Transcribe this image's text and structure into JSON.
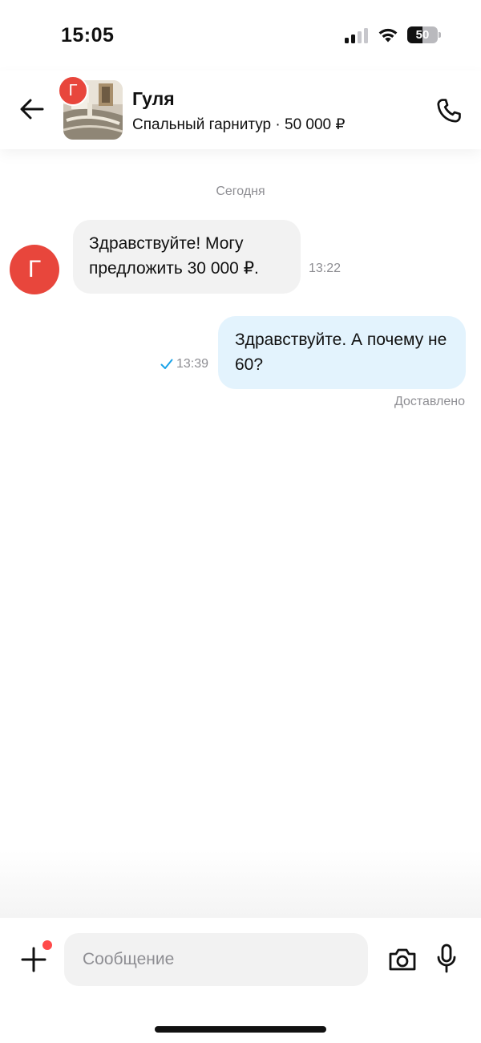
{
  "status_bar": {
    "time": "15:05",
    "battery_level": "50",
    "icons": [
      "signal-icon",
      "wifi-icon",
      "battery-icon"
    ]
  },
  "header": {
    "contact_name": "Гуля",
    "contact_initial": "Г",
    "listing_title": "Спальный гарнитур · 50 000 ₽",
    "icons": [
      "back-arrow-icon",
      "phone-icon"
    ]
  },
  "conversation": {
    "date_label": "Сегодня",
    "messages": [
      {
        "direction": "incoming",
        "sender_initial": "Г",
        "text": "Здравствуйте! Могу предложить 30 000 ₽.",
        "time": "13:22"
      },
      {
        "direction": "outgoing",
        "text": "Здравствуйте. А почему не 60?",
        "time": "13:39",
        "status": "Доставлено"
      }
    ]
  },
  "composer": {
    "placeholder": "Сообщение",
    "value": "",
    "icons": [
      "plus-icon",
      "camera-icon",
      "microphone-icon"
    ]
  },
  "colors": {
    "accent_red": "#e8463c",
    "incoming_bubble": "#f2f2f2",
    "outgoing_bubble": "#e3f3fd",
    "check_blue": "#1aa3e8",
    "muted_text": "#8e8e93"
  }
}
